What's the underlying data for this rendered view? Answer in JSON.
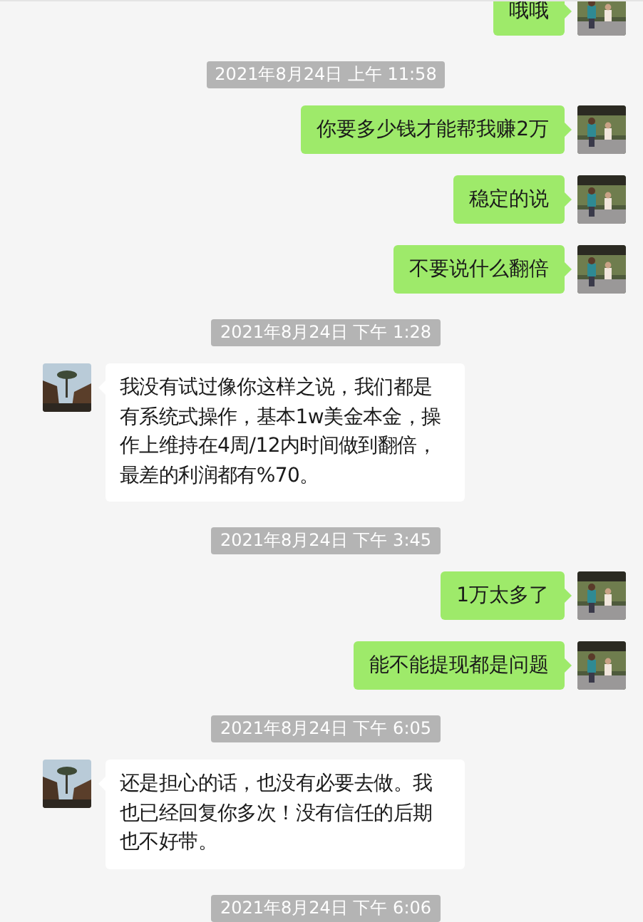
{
  "messages": [
    {
      "kind": "sent",
      "text": "哦哦"
    },
    {
      "kind": "time",
      "text": "2021年8月24日 上午 11:58"
    },
    {
      "kind": "sent",
      "text": "你要多少钱才能帮我赚2万"
    },
    {
      "kind": "sent",
      "text": "稳定的说"
    },
    {
      "kind": "sent",
      "text": "不要说什么翻倍"
    },
    {
      "kind": "time",
      "text": "2021年8月24日 下午 1:28"
    },
    {
      "kind": "received",
      "text": "我没有试过像你这样之说，我们都是有系统式操作，基本1w美金本金，操作上维持在4周/12内时间做到翻倍，最差的利润都有%70。"
    },
    {
      "kind": "time",
      "text": "2021年8月24日 下午 3:45"
    },
    {
      "kind": "sent",
      "text": "1万太多了"
    },
    {
      "kind": "sent",
      "text": "能不能提现都是问题"
    },
    {
      "kind": "time",
      "text": "2021年8月24日 下午 6:05"
    },
    {
      "kind": "received",
      "text": "还是担心的话，也没有必要去做。我也已经回复你多次！没有信任的后期也不好带。"
    },
    {
      "kind": "time",
      "text": "2021年8月24日 下午 6:06"
    }
  ]
}
